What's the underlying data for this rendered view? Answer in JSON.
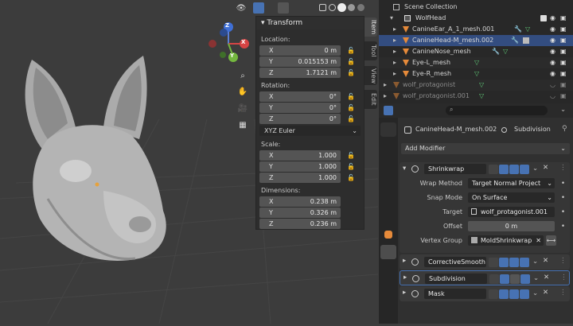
{
  "viewport": {
    "head_alt": "wolf head 3d model",
    "gizmo": {
      "x": "X",
      "y": "Y",
      "z": "Z"
    }
  },
  "npanel": {
    "title": "Transform",
    "location_label": "Location:",
    "rotation_label": "Rotation:",
    "scale_label": "Scale:",
    "dimensions_label": "Dimensions:",
    "location": [
      {
        "axis": "X",
        "value": "0 m"
      },
      {
        "axis": "Y",
        "value": "0.015153 m"
      },
      {
        "axis": "Z",
        "value": "1.7121 m"
      }
    ],
    "rotation": [
      {
        "axis": "X",
        "value": "0°"
      },
      {
        "axis": "Y",
        "value": "0°"
      },
      {
        "axis": "Z",
        "value": "0°"
      }
    ],
    "rotation_mode": "XYZ Euler",
    "scale": [
      {
        "axis": "X",
        "value": "1.000"
      },
      {
        "axis": "Y",
        "value": "1.000"
      },
      {
        "axis": "Z",
        "value": "1.000"
      }
    ],
    "dimensions": [
      {
        "axis": "X",
        "value": "0.238 m"
      },
      {
        "axis": "Y",
        "value": "0.326 m"
      },
      {
        "axis": "Z",
        "value": "0.236 m"
      }
    ],
    "tabs": [
      "Item",
      "Tool",
      "View",
      "Edit"
    ]
  },
  "outliner": {
    "scene": "Scene Collection",
    "collection": "WolfHead",
    "items": [
      "CanineEar_A_1_mesh.001",
      "CanineHead-M_mesh.002",
      "CanineNose_mesh",
      "Eye-L_mesh",
      "Eye-R_mesh",
      "wolf_protagonist",
      "wolf_protagonist.001"
    ]
  },
  "properties": {
    "object_name": "CanineHead-M_mesh.002",
    "modifier_ref": "Subdivision",
    "add_modifier": "Add Modifier",
    "shrinkwrap": {
      "name": "Shrinkwrap",
      "wrap_method_label": "Wrap Method",
      "wrap_method": "Target Normal Project",
      "snap_mode_label": "Snap Mode",
      "snap_mode": "On Surface",
      "target_label": "Target",
      "target": "wolf_protagonist.001",
      "offset_label": "Offset",
      "offset": "0 m",
      "vgroup_label": "Vertex Group",
      "vgroup": "MoldShrinkwrap"
    },
    "modifiers": [
      "CorrectiveSmooth",
      "Subdivision",
      "Mask"
    ]
  },
  "colors": {
    "accent": "#4772b3",
    "selected": "#334d80",
    "mesh_icon": "#e68a3a",
    "green_icon": "#5fc977"
  }
}
